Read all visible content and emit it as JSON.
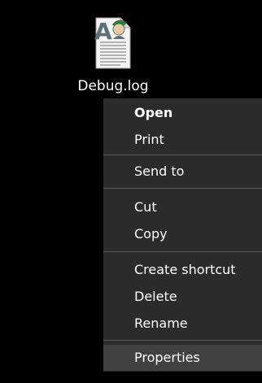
{
  "file": {
    "name": "Debug.log",
    "icon": "log-file-icon",
    "watermark_letter": "A"
  },
  "menu": {
    "items": [
      {
        "label": "Open",
        "bold": true
      },
      {
        "label": "Print"
      },
      {
        "label": "Send to"
      },
      {
        "label": "Cut"
      },
      {
        "label": "Copy"
      },
      {
        "label": "Create shortcut"
      },
      {
        "label": "Delete"
      },
      {
        "label": "Rename"
      },
      {
        "label": "Properties",
        "highlighted": true
      }
    ]
  },
  "colors": {
    "background": "#000000",
    "menu_background": "#2b2b2b",
    "menu_highlight": "#414141",
    "separator": "#5a5a5a",
    "text": "#ffffff"
  }
}
